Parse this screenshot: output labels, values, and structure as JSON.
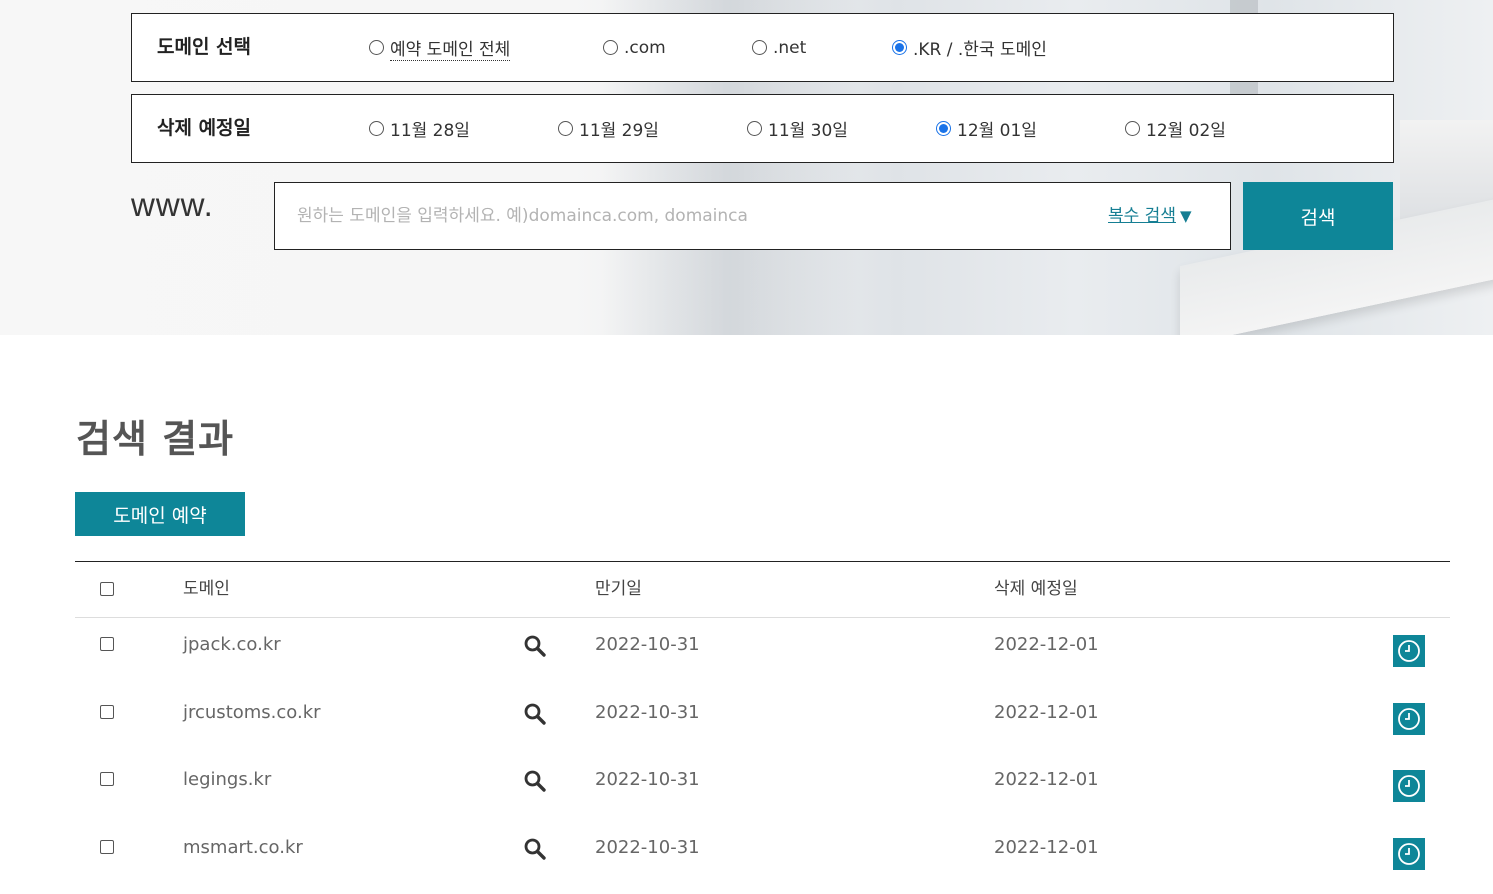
{
  "filters": {
    "domain": {
      "label": "도메인 선택",
      "options": [
        {
          "label": "예약 도메인 전체",
          "checked": false
        },
        {
          "label": ".com",
          "checked": false
        },
        {
          "label": ".net",
          "checked": false
        },
        {
          "label": ".KR / .한국 도메인",
          "checked": true
        }
      ]
    },
    "date": {
      "label": "삭제 예정일",
      "options": [
        {
          "label": "11월 28일",
          "checked": false
        },
        {
          "label": "11월 29일",
          "checked": false
        },
        {
          "label": "11월 30일",
          "checked": false
        },
        {
          "label": "12월 01일",
          "checked": true
        },
        {
          "label": "12월 02일",
          "checked": false
        }
      ]
    }
  },
  "search": {
    "prefix": "www.",
    "placeholder": "원하는 도메인을 입력하세요. 예)domainca.com, domainca",
    "multi_label": "복수 검색",
    "multi_icon": "▼",
    "button_label": "검색"
  },
  "results": {
    "title": "검색 결과",
    "reserve_button": "도메인 예약",
    "headers": {
      "domain": "도메인",
      "expire": "만기일",
      "delete": "삭제 예정일"
    },
    "rows": [
      {
        "domain": "jpack.co.kr",
        "expire": "2022-10-31",
        "delete": "2022-12-01"
      },
      {
        "domain": "jrcustoms.co.kr",
        "expire": "2022-10-31",
        "delete": "2022-12-01"
      },
      {
        "domain": "legings.kr",
        "expire": "2022-10-31",
        "delete": "2022-12-01"
      },
      {
        "domain": "msmart.co.kr",
        "expire": "2022-10-31",
        "delete": "2022-12-01"
      }
    ]
  },
  "colors": {
    "accent": "#0e8698",
    "link": "#157e93",
    "radio_checked": "#1a73e8"
  },
  "icons": {
    "row_search": "magnifier-icon",
    "row_action": "clock-icon"
  }
}
